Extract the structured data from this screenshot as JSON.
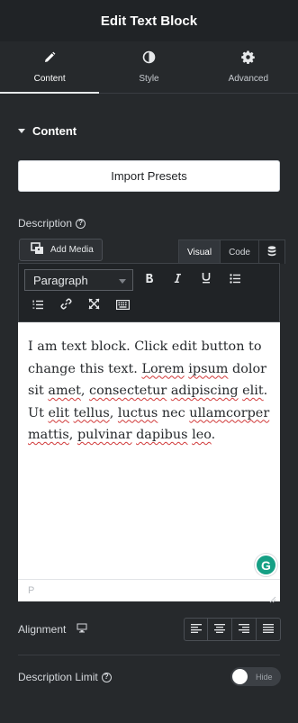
{
  "header": {
    "title": "Edit Text Block"
  },
  "tabs": [
    {
      "label": "Content",
      "icon": "pencil-icon",
      "active": true
    },
    {
      "label": "Style",
      "icon": "contrast-icon",
      "active": false
    },
    {
      "label": "Advanced",
      "icon": "gear-icon",
      "active": false
    }
  ],
  "section": {
    "title": "Content",
    "expanded": true
  },
  "import_presets": {
    "label": "Import Presets"
  },
  "description": {
    "label": "Description",
    "help_icon": "question-circle-icon",
    "add_media_label": "Add Media",
    "mode_tabs": [
      "Visual",
      "Code"
    ],
    "active_mode": "Visual",
    "format_select": "Paragraph",
    "text_parts": [
      {
        "t": "I am text block. Click edit button to change this text. ",
        "s": false
      },
      {
        "t": "Lorem",
        "s": true
      },
      {
        "t": " ",
        "s": false
      },
      {
        "t": "ipsum",
        "s": true
      },
      {
        "t": " dolor sit ",
        "s": false
      },
      {
        "t": "amet",
        "s": true
      },
      {
        "t": ", ",
        "s": false
      },
      {
        "t": "consectetur",
        "s": true
      },
      {
        "t": " ",
        "s": false
      },
      {
        "t": "adipiscing",
        "s": true
      },
      {
        "t": " ",
        "s": false
      },
      {
        "t": "elit",
        "s": true
      },
      {
        "t": ". Ut ",
        "s": false
      },
      {
        "t": "elit",
        "s": true
      },
      {
        "t": " ",
        "s": false
      },
      {
        "t": "tellus",
        "s": true
      },
      {
        "t": ", ",
        "s": false
      },
      {
        "t": "luctus",
        "s": true
      },
      {
        "t": " nec ",
        "s": false
      },
      {
        "t": "ullamcorper",
        "s": true
      },
      {
        "t": " ",
        "s": false
      },
      {
        "t": "mattis",
        "s": true
      },
      {
        "t": ", ",
        "s": false
      },
      {
        "t": "pulvinar",
        "s": true
      },
      {
        "t": " ",
        "s": false
      },
      {
        "t": "dapibus",
        "s": true
      },
      {
        "t": " ",
        "s": false
      },
      {
        "t": "leo",
        "s": true
      },
      {
        "t": ".",
        "s": false
      }
    ],
    "status_path": "P"
  },
  "alignment": {
    "label": "Alignment",
    "device_icon": "desktop-icon",
    "options": [
      "align-left-icon",
      "align-center-icon",
      "align-right-icon",
      "align-justify-icon"
    ]
  },
  "description_limit": {
    "label": "Description Limit",
    "toggle_label": "Hide",
    "enabled": false
  },
  "colors": {
    "panel_bg": "#26292c",
    "header_bg": "#202326",
    "grammarly": "#16a085",
    "spellcheck": "#d13a3a"
  }
}
